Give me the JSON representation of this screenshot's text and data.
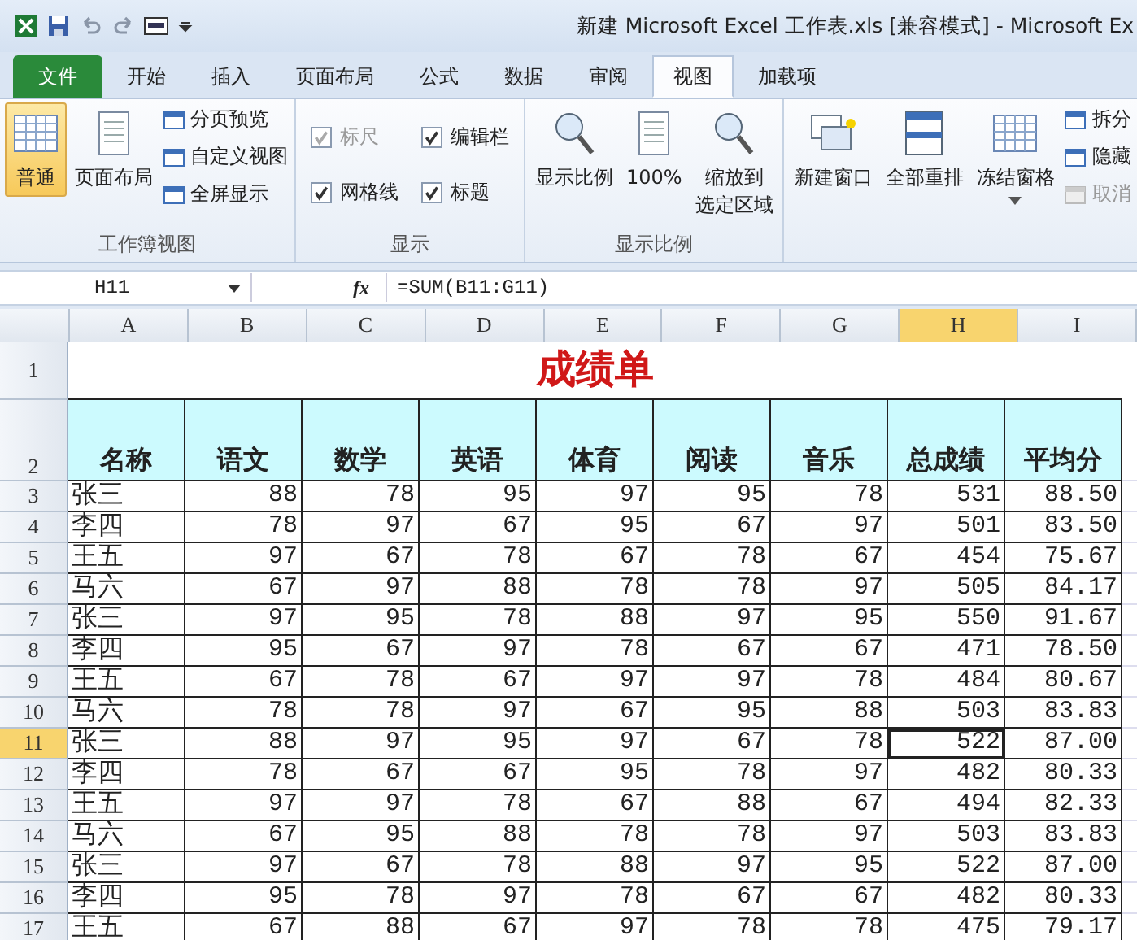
{
  "window": {
    "title": "新建 Microsoft Excel 工作表.xls  [兼容模式]  -  Microsoft Ex"
  },
  "tabs": [
    {
      "label": "文件",
      "kind": "file",
      "selected": false
    },
    {
      "label": "开始",
      "kind": "tab",
      "selected": false
    },
    {
      "label": "插入",
      "kind": "tab",
      "selected": false
    },
    {
      "label": "页面布局",
      "kind": "tab",
      "selected": false
    },
    {
      "label": "公式",
      "kind": "tab",
      "selected": false
    },
    {
      "label": "数据",
      "kind": "tab",
      "selected": false
    },
    {
      "label": "审阅",
      "kind": "tab",
      "selected": false
    },
    {
      "label": "视图",
      "kind": "tab",
      "selected": true
    },
    {
      "label": "加载项",
      "kind": "tab",
      "selected": false
    }
  ],
  "ribbon": {
    "groups": [
      {
        "label": "工作簿视图",
        "columns": [
          [
            {
              "kind": "large",
              "label": "普通",
              "selected": true
            }
          ],
          [
            {
              "kind": "large",
              "label": "页面布局",
              "selected": false
            }
          ],
          [
            {
              "kind": "small",
              "label": "分页预览",
              "disabled": false
            },
            {
              "kind": "small",
              "label": "自定义视图",
              "disabled": false
            },
            {
              "kind": "small",
              "label": "全屏显示",
              "disabled": false
            }
          ]
        ]
      },
      {
        "label": "显示",
        "columns": [
          [
            {
              "kind": "checkbox",
              "label": "标尺",
              "checked": true,
              "disabled": true
            },
            {
              "kind": "checkbox",
              "label": "网格线",
              "checked": true,
              "disabled": false
            }
          ],
          [
            {
              "kind": "checkbox",
              "label": "编辑栏",
              "checked": true,
              "disabled": false
            },
            {
              "kind": "checkbox",
              "label": "标题",
              "checked": true,
              "disabled": false
            }
          ]
        ]
      },
      {
        "label": "显示比例",
        "columns": [
          [
            {
              "kind": "large",
              "label": "显示比例",
              "selected": false
            }
          ],
          [
            {
              "kind": "large",
              "label": "100%",
              "selected": false
            }
          ],
          [
            {
              "kind": "large",
              "lines": [
                "缩放到",
                "选定区域"
              ],
              "selected": false
            }
          ]
        ]
      },
      {
        "columns": [
          [
            {
              "kind": "large",
              "label": "新建窗口",
              "selected": false
            }
          ],
          [
            {
              "kind": "large",
              "label": "全部重排",
              "selected": false
            }
          ],
          [
            {
              "kind": "large",
              "label": "冻结窗格",
              "selected": false,
              "dropdown": true
            }
          ],
          [
            {
              "kind": "small",
              "label": "拆分",
              "disabled": false
            },
            {
              "kind": "small",
              "label": "隐藏",
              "disabled": false
            },
            {
              "kind": "small",
              "label": "取消",
              "disabled": true
            }
          ]
        ]
      }
    ]
  },
  "formula_bar": {
    "name_box": "H11",
    "fx": "fx",
    "formula": "=SUM(B11:G11)"
  },
  "sheet": {
    "columns": [
      {
        "label": "A",
        "selected": false
      },
      {
        "label": "B",
        "selected": false
      },
      {
        "label": "C",
        "selected": false
      },
      {
        "label": "D",
        "selected": false
      },
      {
        "label": "E",
        "selected": false
      },
      {
        "label": "F",
        "selected": false
      },
      {
        "label": "G",
        "selected": false
      },
      {
        "label": "H",
        "selected": true
      },
      {
        "label": "I",
        "selected": false
      }
    ],
    "title_row": {
      "number": "1",
      "title": "成绩单"
    },
    "header_row": {
      "number": "2",
      "cells": [
        "名称",
        "语文",
        "数学",
        "英语",
        "体育",
        "阅读",
        "音乐",
        "总成绩",
        "平均分"
      ]
    },
    "rows": [
      {
        "number": "3",
        "selected": false,
        "cells": [
          "张三",
          "88",
          "78",
          "95",
          "97",
          "95",
          "78",
          "531",
          "88.50"
        ]
      },
      {
        "number": "4",
        "selected": false,
        "cells": [
          "李四",
          "78",
          "97",
          "67",
          "95",
          "67",
          "97",
          "501",
          "83.50"
        ]
      },
      {
        "number": "5",
        "selected": false,
        "cells": [
          "王五",
          "97",
          "67",
          "78",
          "67",
          "78",
          "67",
          "454",
          "75.67"
        ]
      },
      {
        "number": "6",
        "selected": false,
        "cells": [
          "马六",
          "67",
          "97",
          "88",
          "78",
          "78",
          "97",
          "505",
          "84.17"
        ]
      },
      {
        "number": "7",
        "selected": false,
        "cells": [
          "张三",
          "97",
          "95",
          "78",
          "88",
          "97",
          "95",
          "550",
          "91.67"
        ]
      },
      {
        "number": "8",
        "selected": false,
        "cells": [
          "李四",
          "95",
          "67",
          "97",
          "78",
          "67",
          "67",
          "471",
          "78.50"
        ]
      },
      {
        "number": "9",
        "selected": false,
        "cells": [
          "王五",
          "67",
          "78",
          "67",
          "97",
          "97",
          "78",
          "484",
          "80.67"
        ]
      },
      {
        "number": "10",
        "selected": false,
        "cells": [
          "马六",
          "78",
          "78",
          "97",
          "67",
          "95",
          "88",
          "503",
          "83.83"
        ]
      },
      {
        "number": "11",
        "selected": true,
        "cells": [
          "张三",
          "88",
          "97",
          "95",
          "97",
          "67",
          "78",
          "522",
          "87.00"
        ]
      },
      {
        "number": "12",
        "selected": false,
        "cells": [
          "李四",
          "78",
          "67",
          "67",
          "95",
          "78",
          "97",
          "482",
          "80.33"
        ]
      },
      {
        "number": "13",
        "selected": false,
        "cells": [
          "王五",
          "97",
          "97",
          "78",
          "67",
          "88",
          "67",
          "494",
          "82.33"
        ]
      },
      {
        "number": "14",
        "selected": false,
        "cells": [
          "马六",
          "67",
          "95",
          "88",
          "78",
          "78",
          "97",
          "503",
          "83.83"
        ]
      },
      {
        "number": "15",
        "selected": false,
        "cells": [
          "张三",
          "97",
          "67",
          "78",
          "88",
          "97",
          "95",
          "522",
          "87.00"
        ]
      },
      {
        "number": "16",
        "selected": false,
        "cells": [
          "李四",
          "95",
          "78",
          "97",
          "78",
          "67",
          "67",
          "482",
          "80.33"
        ]
      },
      {
        "number": "17",
        "selected": false,
        "cells": [
          "王五",
          "67",
          "88",
          "67",
          "97",
          "78",
          "78",
          "475",
          "79.17"
        ]
      }
    ]
  }
}
